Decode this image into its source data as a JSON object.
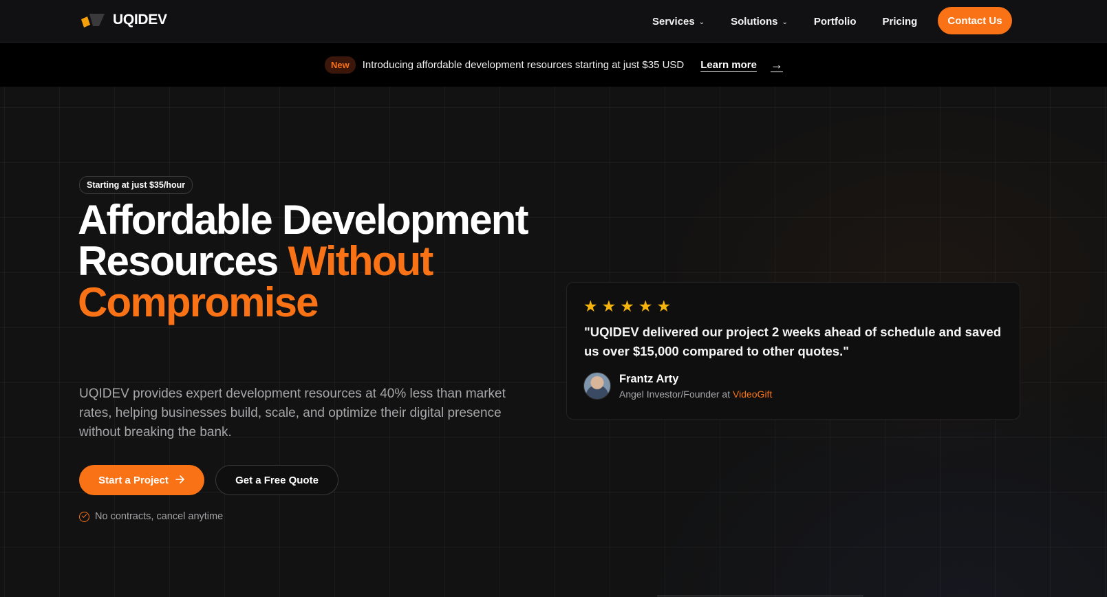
{
  "nav": {
    "logo_text": "UQIDEV",
    "links": [
      {
        "label": "Services",
        "has_dropdown": true
      },
      {
        "label": "Solutions",
        "has_dropdown": true
      },
      {
        "label": "Portfolio",
        "has_dropdown": false
      },
      {
        "label": "Pricing",
        "has_dropdown": false
      }
    ],
    "contact_label": "Contact Us"
  },
  "announcement": {
    "badge": "New",
    "text": "Introducing affordable development resources starting at just $35 USD",
    "link_label": "Learn more",
    "arrow": "→"
  },
  "hero": {
    "pill": "Starting at just $35/hour",
    "headline_white": "Affordable Development Resources",
    "headline_orange": "Without Compromise",
    "subtitle": "UQIDEV provides expert development resources at 40% less than market rates, helping businesses build, scale, and optimize their digital presence without breaking the bank.",
    "primary_cta": "Start a Project",
    "secondary_cta": "Get a Free Quote",
    "assurance": "No contracts, cancel anytime"
  },
  "testimonial": {
    "rating": 5,
    "quote": "\"UQIDEV delivered our project 2 weeks ahead of schedule and saved us over $15,000 compared to other quotes.\"",
    "author_name": "Frantz Arty",
    "author_role": "Angel Investor/Founder at",
    "author_company": "VideoGift"
  },
  "colors": {
    "accent": "#f97316",
    "star": "#f5b40b",
    "background": "#121212"
  },
  "icons": {
    "logo": "uqidev-logo-icon",
    "dropdown": "chevron-down-icon",
    "arrow": "arrow-right-icon",
    "check": "check-circle-icon",
    "star": "star-icon"
  }
}
